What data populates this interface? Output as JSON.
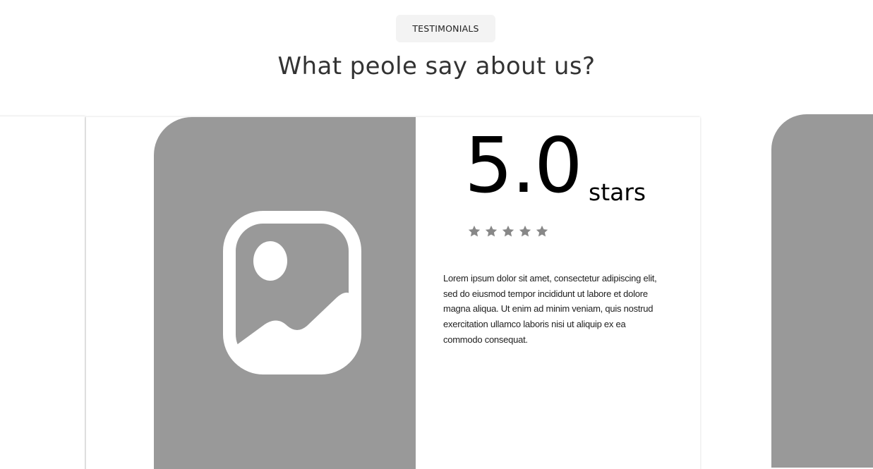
{
  "section": {
    "badge": "TESTIMONIALS",
    "heading": "What peole say about us?"
  },
  "testimonial": {
    "photo_icon": "image-placeholder-icon",
    "rating_value": "5.0",
    "rating_unit": "stars",
    "rating_stars": 5,
    "star_icon": "star-icon",
    "star_color": "#888888",
    "photo_color": "#999999",
    "text": "Lorem ipsum dolor sit amet, consectetur adipiscing elit, sed do eiusmod tempor incididunt ut labore et dolore magna aliqua. Ut enim ad minim veniam, quis nostrud exercitation ullamco laboris nisi ut aliquip ex ea commodo consequat."
  }
}
